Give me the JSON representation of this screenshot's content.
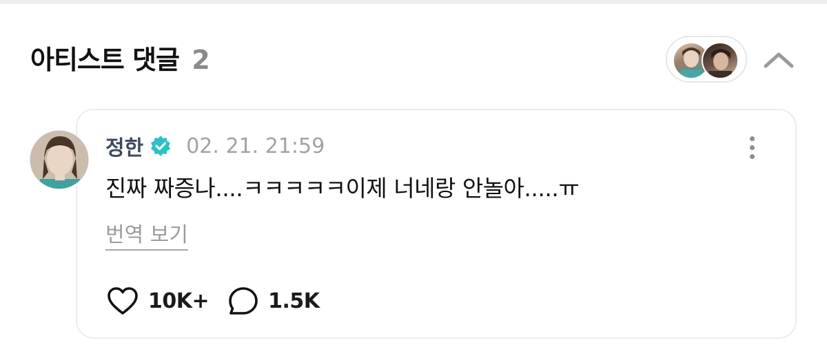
{
  "header": {
    "title": "아티스트 댓글",
    "count": "2",
    "participant_avatars": [
      "artist-avatar",
      "artist-avatar"
    ],
    "collapse_icon": "chevron-up-icon"
  },
  "comment": {
    "author": "정한",
    "verified_icon": "verified-badge-icon",
    "verified_color": "#2bc1c9",
    "timestamp": "02. 21. 21:59",
    "text": "진짜 짜증나....ㅋㅋㅋㅋㅋ이제 너네랑 안놀아.....ㅠ",
    "translate_label": "번역 보기",
    "more_icon": "more-vertical-icon",
    "likes": {
      "icon": "heart-icon",
      "count": "10K+"
    },
    "replies": {
      "icon": "comment-bubble-icon",
      "count": "1.5K"
    }
  }
}
